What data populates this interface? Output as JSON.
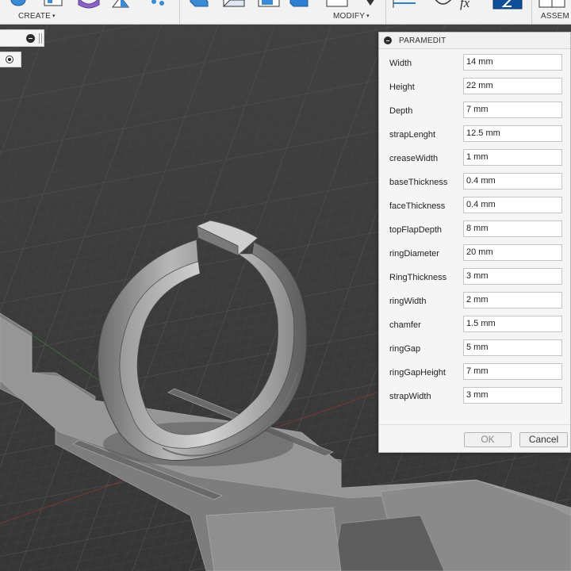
{
  "toolbar": {
    "create_label": "CREATE",
    "modify_label": "MODIFY",
    "assemble_label": "ASSEM",
    "formula_glyph": "fx",
    "caret": "▾"
  },
  "dialog": {
    "title": "PARAMEDIT",
    "ok_label": "OK",
    "cancel_label": "Cancel",
    "params": [
      {
        "label": "Width",
        "value": "14 mm"
      },
      {
        "label": "Height",
        "value": "22 mm"
      },
      {
        "label": "Depth",
        "value": "7 mm"
      },
      {
        "label": "strapLenght",
        "value": "12.5 mm"
      },
      {
        "label": "creaseWidth",
        "value": "1 mm"
      },
      {
        "label": "baseThickness",
        "value": "0.4 mm"
      },
      {
        "label": "faceThickness",
        "value": "0.4 mm"
      },
      {
        "label": "topFlapDepth",
        "value": "8 mm"
      },
      {
        "label": "ringDiameter",
        "value": "20 mm"
      },
      {
        "label": "RingThickness",
        "value": "3 mm"
      },
      {
        "label": "ringWidth",
        "value": "2 mm"
      },
      {
        "label": "chamfer",
        "value": "1.5 mm"
      },
      {
        "label": "ringGap",
        "value": "5 mm"
      },
      {
        "label": "ringGapHeight",
        "value": "7 mm"
      },
      {
        "label": "strapWidth",
        "value": "3 mm"
      }
    ]
  },
  "colors": {
    "viewport_bg": "#3c3c3c",
    "model_gray": "#8e8e8e",
    "primary_blue": "#1d6fc9"
  }
}
